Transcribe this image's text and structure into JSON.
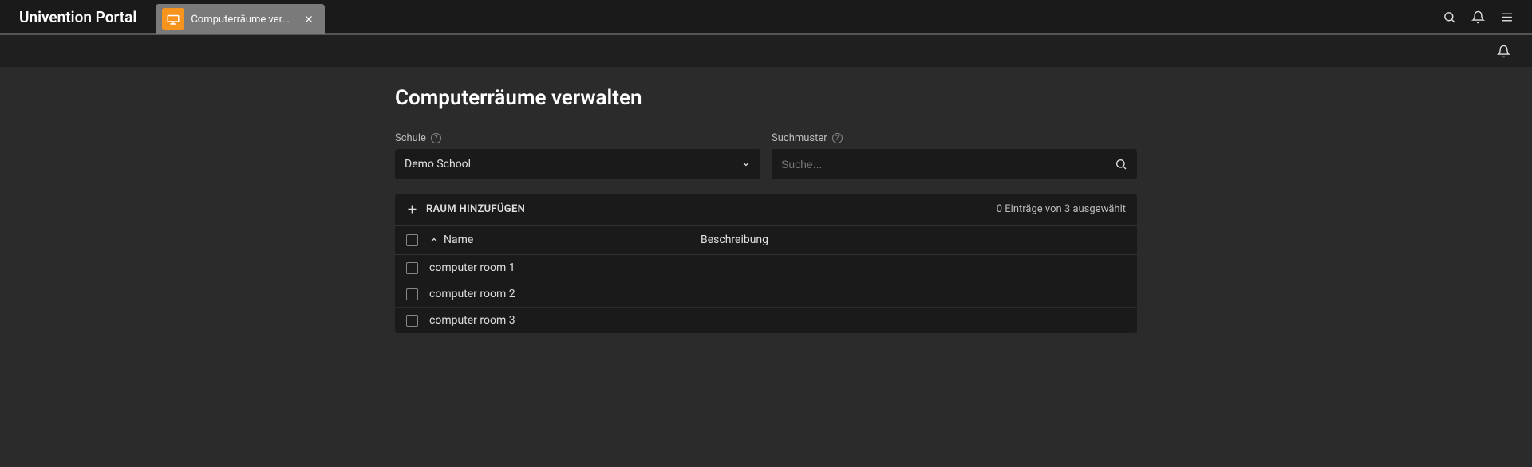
{
  "header": {
    "portal_title": "Univention Portal",
    "tab": {
      "label": "Computerräume verw...",
      "icon": "computer-room-icon"
    }
  },
  "page": {
    "title": "Computerräume verwalten"
  },
  "filters": {
    "school": {
      "label": "Schule",
      "value": "Demo School"
    },
    "search": {
      "label": "Suchmuster",
      "placeholder": "Suche..."
    }
  },
  "table": {
    "add_button": "RAUM HINZUFÜGEN",
    "selection_text": "0 Einträge von 3 ausgewählt",
    "columns": {
      "name": "Name",
      "description": "Beschreibung"
    },
    "rows": [
      {
        "name": "computer room 1",
        "description": ""
      },
      {
        "name": "computer room 2",
        "description": ""
      },
      {
        "name": "computer room 3",
        "description": ""
      }
    ]
  }
}
